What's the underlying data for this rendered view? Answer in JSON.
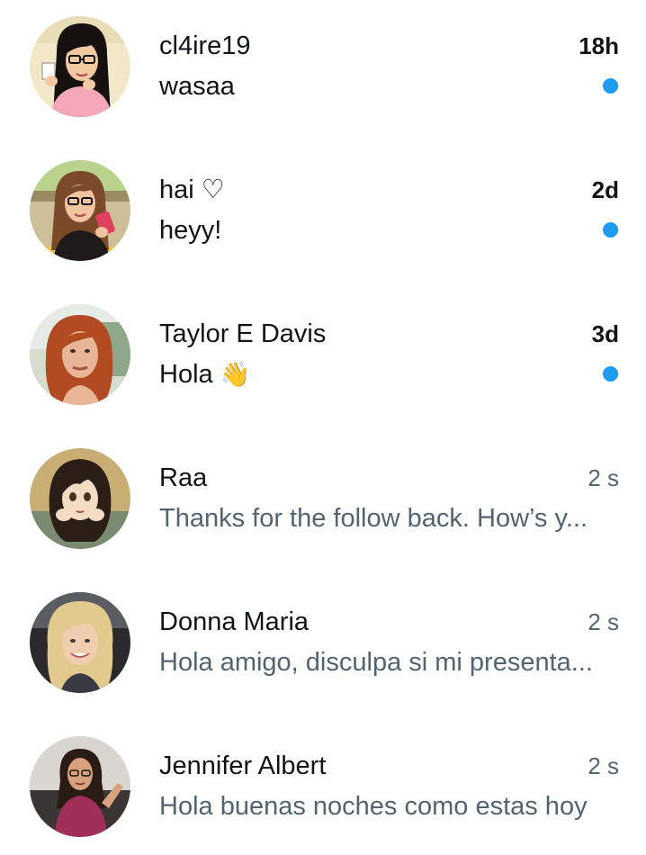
{
  "colors": {
    "unread_dot": "#1d9bf0",
    "primary_text": "#0f1419",
    "secondary_text": "#536471"
  },
  "conversations": [
    {
      "name": "cl4ire19",
      "time": "18h",
      "preview": "wasaa",
      "unread": true,
      "avatar": "cartoon-glasses-girl"
    },
    {
      "name": "hai ♡",
      "time": "2d",
      "preview": "heyy!",
      "unread": true,
      "avatar": "cartoon-brunette-phone"
    },
    {
      "name": "Taylor E Davis",
      "time": "3d",
      "preview": "Hola",
      "preview_emoji": "👋",
      "unread": true,
      "avatar": "redhead-photo"
    },
    {
      "name": "Raa",
      "time": "2 s",
      "preview": "Thanks for the follow back. How’s y...",
      "unread": false,
      "avatar": "anime-girl"
    },
    {
      "name": "Donna Maria",
      "time": "2 s",
      "preview": "Hola amigo, disculpa si mi presenta...",
      "unread": false,
      "avatar": "blonde-photo"
    },
    {
      "name": "Jennifer Albert",
      "time": "2 s",
      "preview": "Hola buenas noches como estas hoy",
      "unread": false,
      "avatar": "selfie-photo"
    }
  ]
}
